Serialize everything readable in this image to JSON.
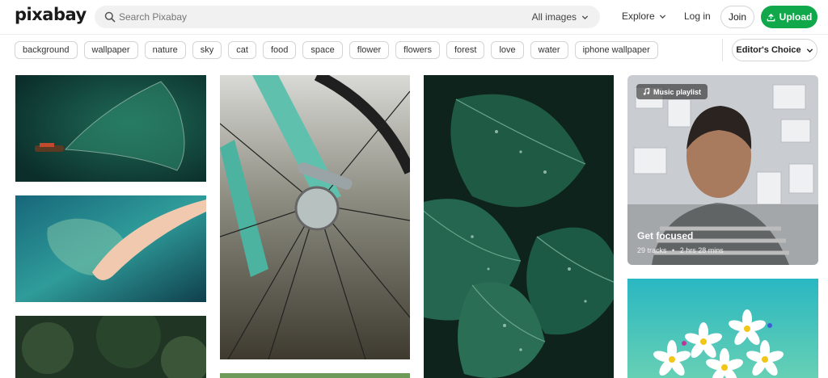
{
  "header": {
    "logo_text": "pixabay",
    "search": {
      "placeholder": "Search Pixabay",
      "value": ""
    },
    "filter_label": "All images",
    "nav": {
      "explore": "Explore",
      "login": "Log in"
    },
    "join_label": "Join",
    "upload_label": "Upload"
  },
  "tags": [
    "background",
    "wallpaper",
    "nature",
    "sky",
    "cat",
    "food",
    "space",
    "flower",
    "flowers",
    "forest",
    "love",
    "water",
    "iphone wallpaper"
  ],
  "sort_label": "Editor's Choice",
  "playlist": {
    "badge": "Music playlist",
    "title": "Get focused",
    "tracks": "29 tracks",
    "separator": "•",
    "duration": "2 hrs 28 mins"
  },
  "colors": {
    "accent_green": "#10a84a",
    "search_bg": "#f1f1f1",
    "tag_border": "#d4d4d4"
  },
  "icons": {
    "search": "search-icon",
    "chevron": "chevron-down-icon",
    "upload": "upload-icon",
    "music": "music-note-icon"
  }
}
